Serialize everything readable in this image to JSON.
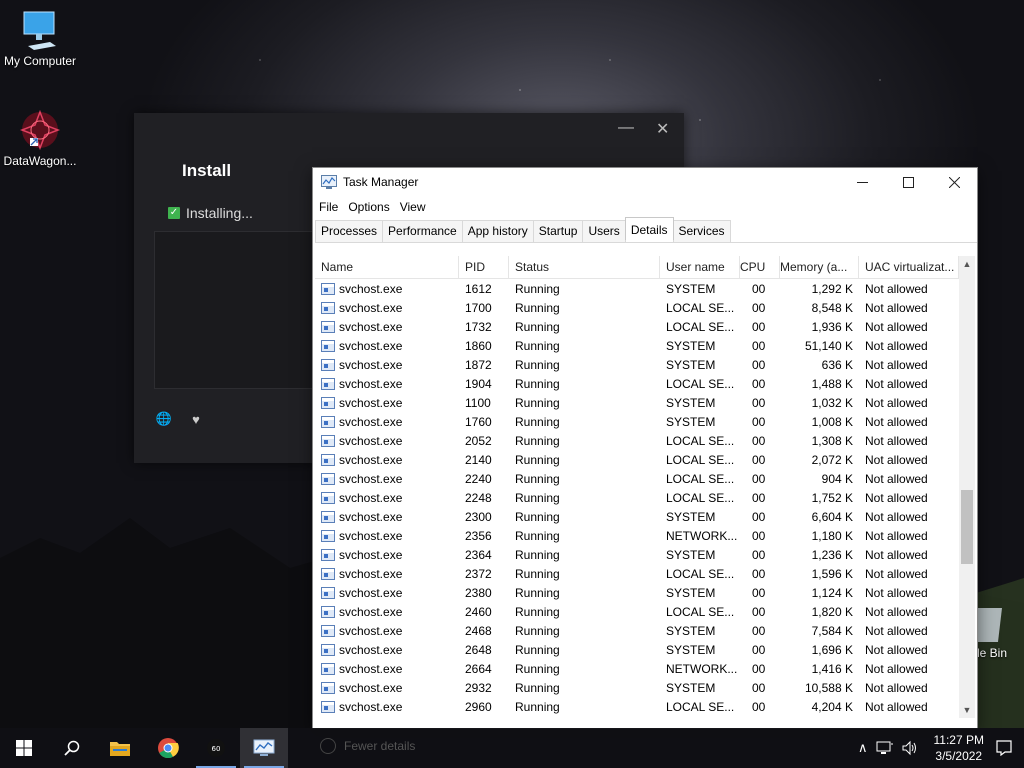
{
  "desktop": {
    "icons": [
      {
        "label": "My Computer"
      },
      {
        "label": "DataWagon..."
      },
      {
        "label": "le Bin"
      }
    ]
  },
  "installer": {
    "title": "Install",
    "status": "Installing...",
    "minimize": "—",
    "close": "✕"
  },
  "taskmanager": {
    "title": "Task Manager",
    "menu": [
      "File",
      "Options",
      "View"
    ],
    "tabs": [
      "Processes",
      "Performance",
      "App history",
      "Startup",
      "Users",
      "Details",
      "Services"
    ],
    "active_tab": "Details",
    "columns": [
      "Name",
      "PID",
      "Status",
      "User name",
      "CPU",
      "Memory (a...",
      "UAC virtualizat..."
    ],
    "rows": [
      {
        "name": "svchost.exe",
        "pid": "1612",
        "status": "Running",
        "user": "SYSTEM",
        "cpu": "00",
        "mem": "1,292 K",
        "uac": "Not allowed"
      },
      {
        "name": "svchost.exe",
        "pid": "1700",
        "status": "Running",
        "user": "LOCAL SE...",
        "cpu": "00",
        "mem": "8,548 K",
        "uac": "Not allowed"
      },
      {
        "name": "svchost.exe",
        "pid": "1732",
        "status": "Running",
        "user": "LOCAL SE...",
        "cpu": "00",
        "mem": "1,936 K",
        "uac": "Not allowed"
      },
      {
        "name": "svchost.exe",
        "pid": "1860",
        "status": "Running",
        "user": "SYSTEM",
        "cpu": "00",
        "mem": "51,140 K",
        "uac": "Not allowed"
      },
      {
        "name": "svchost.exe",
        "pid": "1872",
        "status": "Running",
        "user": "SYSTEM",
        "cpu": "00",
        "mem": "636 K",
        "uac": "Not allowed"
      },
      {
        "name": "svchost.exe",
        "pid": "1904",
        "status": "Running",
        "user": "LOCAL SE...",
        "cpu": "00",
        "mem": "1,488 K",
        "uac": "Not allowed"
      },
      {
        "name": "svchost.exe",
        "pid": "1100",
        "status": "Running",
        "user": "SYSTEM",
        "cpu": "00",
        "mem": "1,032 K",
        "uac": "Not allowed"
      },
      {
        "name": "svchost.exe",
        "pid": "1760",
        "status": "Running",
        "user": "SYSTEM",
        "cpu": "00",
        "mem": "1,008 K",
        "uac": "Not allowed"
      },
      {
        "name": "svchost.exe",
        "pid": "2052",
        "status": "Running",
        "user": "LOCAL SE...",
        "cpu": "00",
        "mem": "1,308 K",
        "uac": "Not allowed"
      },
      {
        "name": "svchost.exe",
        "pid": "2140",
        "status": "Running",
        "user": "LOCAL SE...",
        "cpu": "00",
        "mem": "2,072 K",
        "uac": "Not allowed"
      },
      {
        "name": "svchost.exe",
        "pid": "2240",
        "status": "Running",
        "user": "LOCAL SE...",
        "cpu": "00",
        "mem": "904 K",
        "uac": "Not allowed"
      },
      {
        "name": "svchost.exe",
        "pid": "2248",
        "status": "Running",
        "user": "LOCAL SE...",
        "cpu": "00",
        "mem": "1,752 K",
        "uac": "Not allowed"
      },
      {
        "name": "svchost.exe",
        "pid": "2300",
        "status": "Running",
        "user": "SYSTEM",
        "cpu": "00",
        "mem": "6,604 K",
        "uac": "Not allowed"
      },
      {
        "name": "svchost.exe",
        "pid": "2356",
        "status": "Running",
        "user": "NETWORK...",
        "cpu": "00",
        "mem": "1,180 K",
        "uac": "Not allowed"
      },
      {
        "name": "svchost.exe",
        "pid": "2364",
        "status": "Running",
        "user": "SYSTEM",
        "cpu": "00",
        "mem": "1,236 K",
        "uac": "Not allowed"
      },
      {
        "name": "svchost.exe",
        "pid": "2372",
        "status": "Running",
        "user": "LOCAL SE...",
        "cpu": "00",
        "mem": "1,596 K",
        "uac": "Not allowed"
      },
      {
        "name": "svchost.exe",
        "pid": "2380",
        "status": "Running",
        "user": "SYSTEM",
        "cpu": "00",
        "mem": "1,124 K",
        "uac": "Not allowed"
      },
      {
        "name": "svchost.exe",
        "pid": "2460",
        "status": "Running",
        "user": "LOCAL SE...",
        "cpu": "00",
        "mem": "1,820 K",
        "uac": "Not allowed"
      },
      {
        "name": "svchost.exe",
        "pid": "2468",
        "status": "Running",
        "user": "SYSTEM",
        "cpu": "00",
        "mem": "7,584 K",
        "uac": "Not allowed"
      },
      {
        "name": "svchost.exe",
        "pid": "2648",
        "status": "Running",
        "user": "SYSTEM",
        "cpu": "00",
        "mem": "1,696 K",
        "uac": "Not allowed"
      },
      {
        "name": "svchost.exe",
        "pid": "2664",
        "status": "Running",
        "user": "NETWORK...",
        "cpu": "00",
        "mem": "1,416 K",
        "uac": "Not allowed"
      },
      {
        "name": "svchost.exe",
        "pid": "2932",
        "status": "Running",
        "user": "SYSTEM",
        "cpu": "00",
        "mem": "10,588 K",
        "uac": "Not allowed"
      },
      {
        "name": "svchost.exe",
        "pid": "2960",
        "status": "Running",
        "user": "LOCAL SE...",
        "cpu": "00",
        "mem": "4,204 K",
        "uac": "Not allowed"
      }
    ],
    "fewer_details": "Fewer details"
  },
  "taskbar": {
    "time": "11:27 PM",
    "date": "3/5/2022"
  },
  "colors": {
    "taskbar": "#101014",
    "accent": "#7aa7e6",
    "installer_bg": "#202024",
    "check_green": "#3fb34f"
  }
}
